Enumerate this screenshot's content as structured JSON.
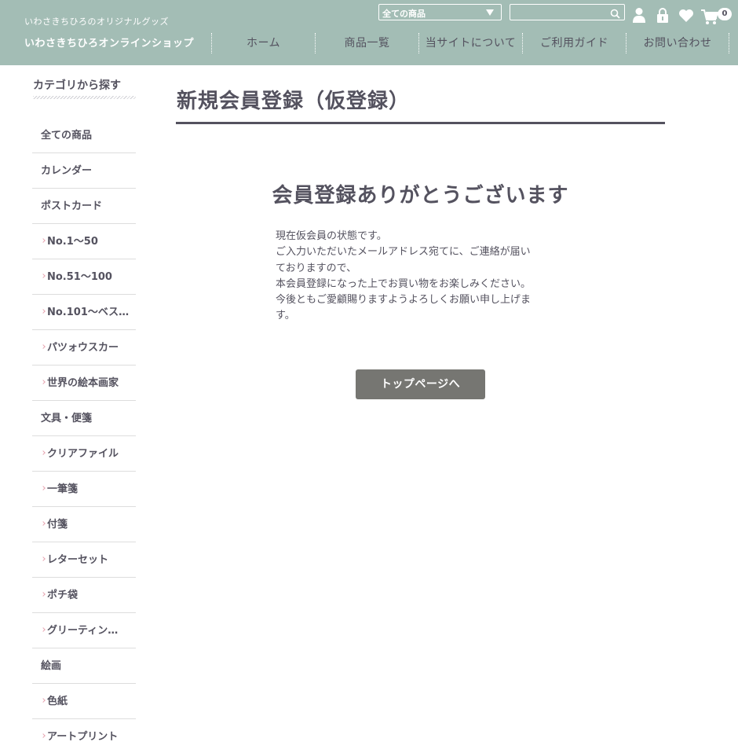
{
  "header": {
    "shop_subtitle": "いわさきちひろのオリジナルグッズ",
    "shop_name": "いわさきちひろオンラインショップ",
    "category_select": {
      "selected": "全ての商品"
    },
    "search": {
      "value": "",
      "placeholder": ""
    },
    "icons": [
      "user-icon",
      "lock-icon",
      "heart-icon",
      "cart-icon"
    ],
    "cart_count": "0",
    "nav": [
      "ホーム",
      "商品一覧",
      "当サイトについて",
      "ご利用ガイド",
      "お問い合わせ"
    ]
  },
  "sidebar": {
    "title": "カテゴリから探す",
    "items": [
      {
        "label": "全ての商品",
        "sub": false
      },
      {
        "label": "カレンダー",
        "sub": false
      },
      {
        "label": "ポストカード",
        "sub": false
      },
      {
        "label": "No.1〜50",
        "sub": true
      },
      {
        "label": "No.51〜100",
        "sub": true
      },
      {
        "label": "No.101〜ベス…",
        "sub": true
      },
      {
        "label": "パツォウスカー",
        "sub": true
      },
      {
        "label": "世界の絵本画家",
        "sub": true
      },
      {
        "label": "文具・便箋",
        "sub": false
      },
      {
        "label": "クリアファイル",
        "sub": true
      },
      {
        "label": "一筆箋",
        "sub": true
      },
      {
        "label": "付箋",
        "sub": true
      },
      {
        "label": "レターセット",
        "sub": true
      },
      {
        "label": "ポチ袋",
        "sub": true
      },
      {
        "label": "グリーティン…",
        "sub": true
      },
      {
        "label": "絵画",
        "sub": false
      },
      {
        "label": "色紙",
        "sub": true
      },
      {
        "label": "アートプリント",
        "sub": true
      }
    ]
  },
  "main": {
    "page_title": "新規会員登録（仮登録）",
    "heading": "会員登録ありがとうございます",
    "message_lines": [
      "現在仮会員の状態です。",
      "ご入力いただいたメールアドレス宛てに、ご連絡が届い",
      "ておりますので、",
      "本会員登録になった上でお買い物をお楽しみください。",
      "今後ともご愛顧賜りますようよろしくお願い申し上げま",
      "す。"
    ],
    "button_label": "トップページへ"
  },
  "colors": {
    "header_bg": "#a3bdb5",
    "text": "#54525f",
    "button_bg": "#767672",
    "sub_marker": "#e7a7b3"
  }
}
